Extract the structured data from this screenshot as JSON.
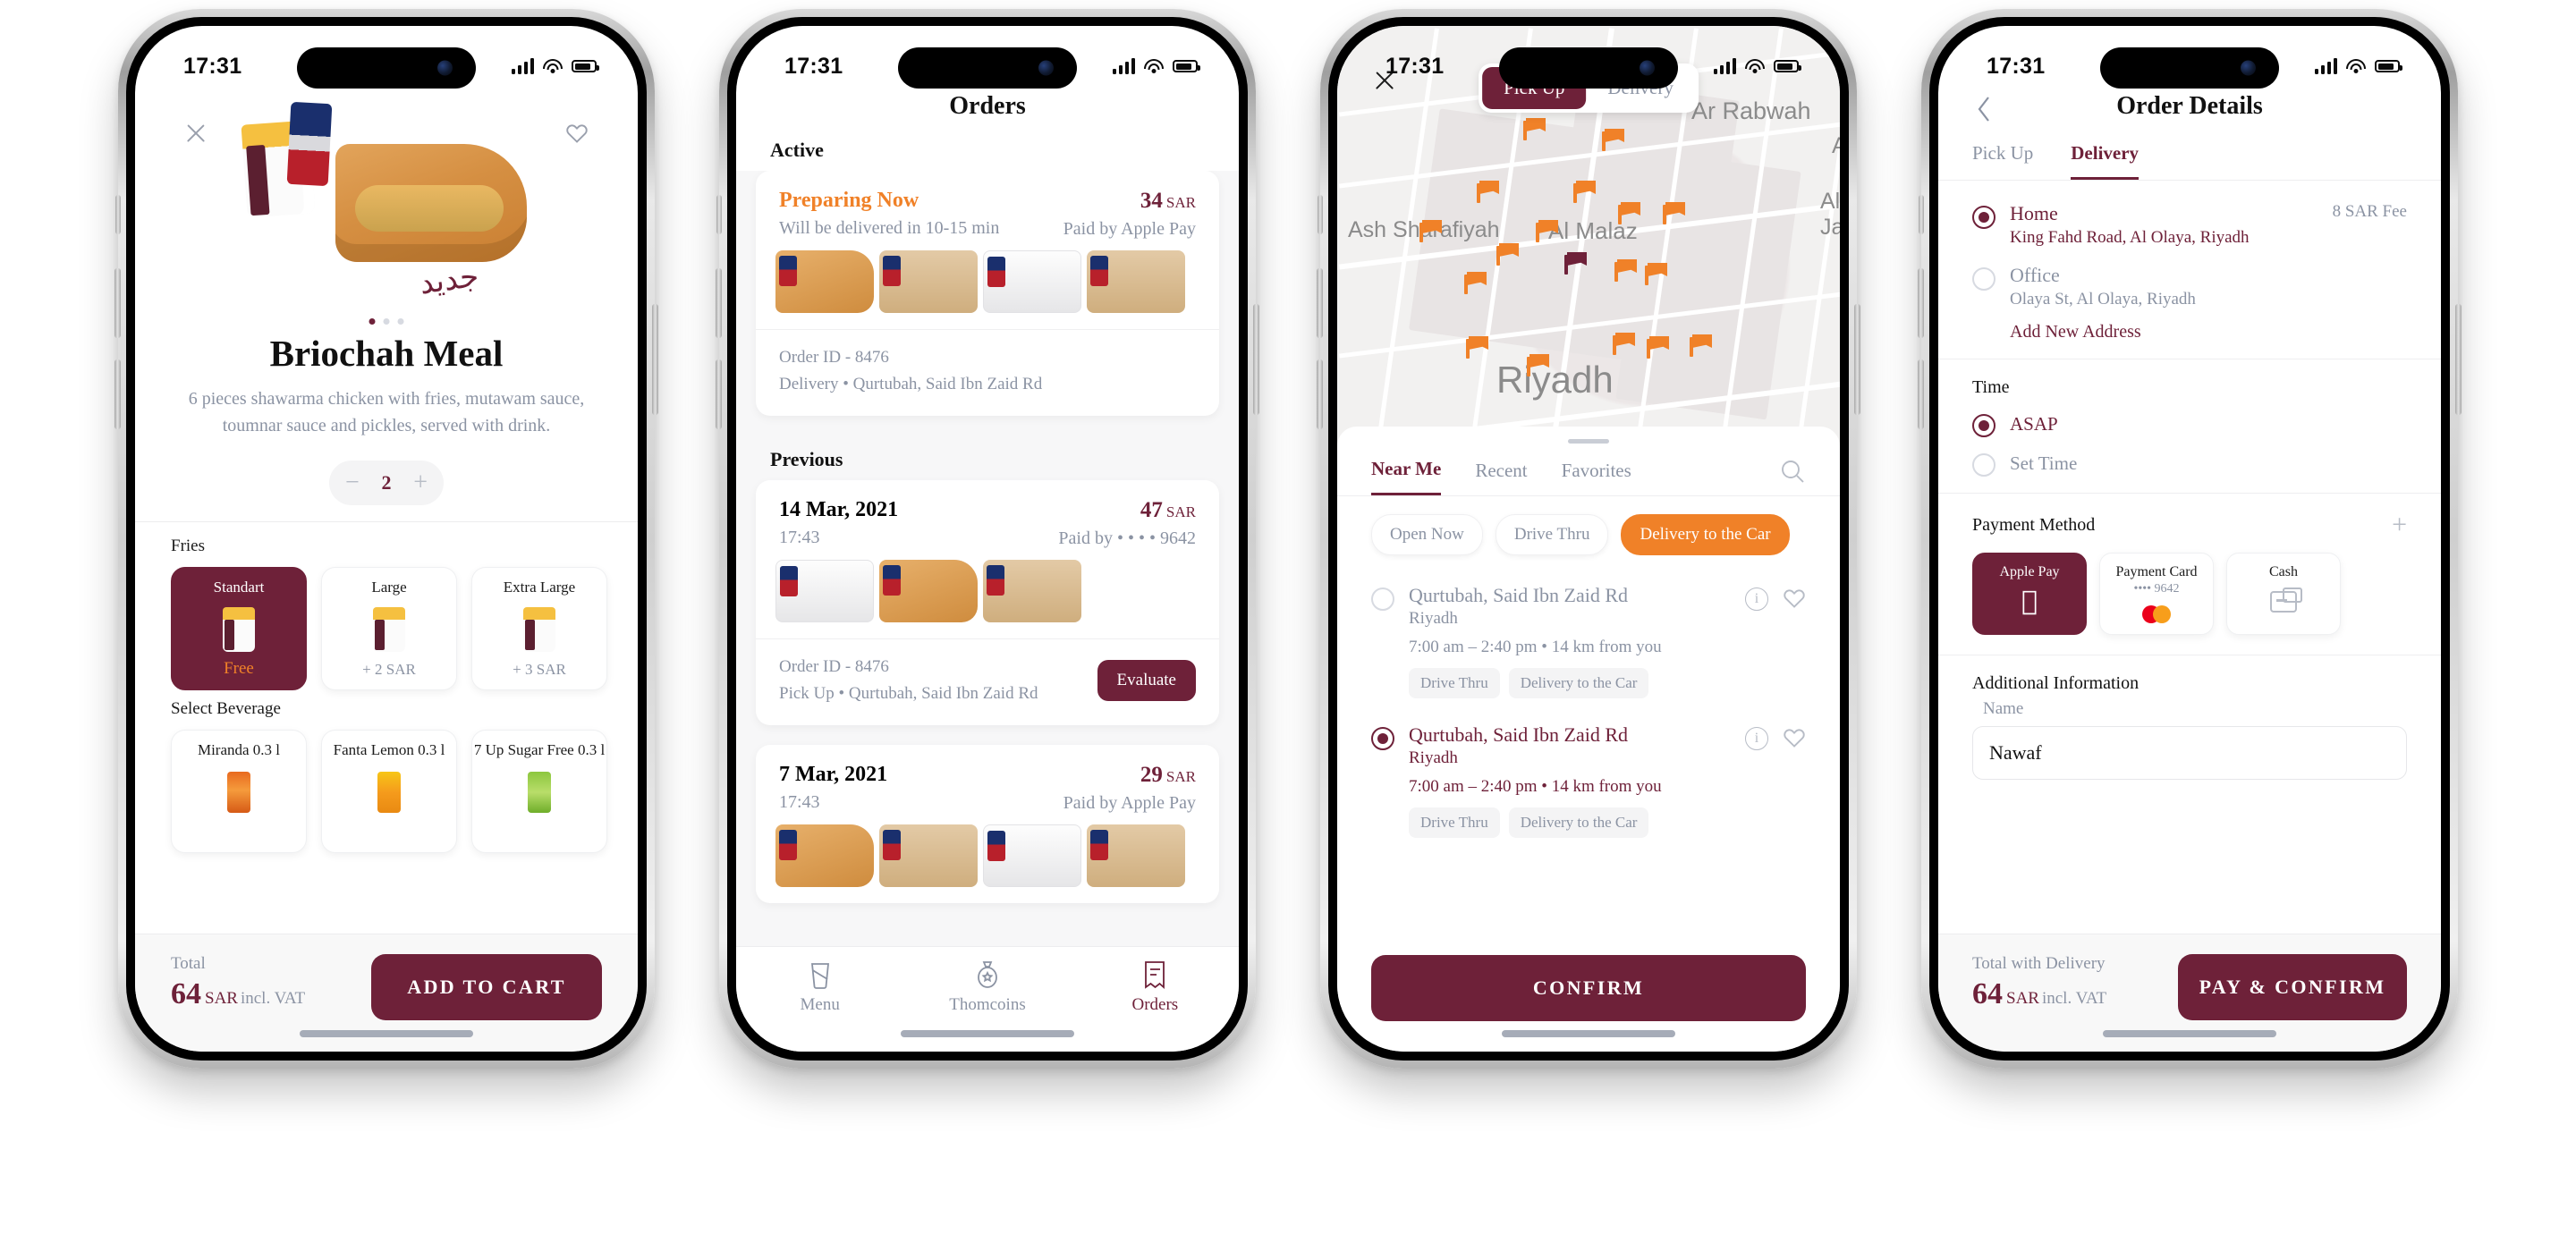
{
  "status_bar": {
    "time": "17:31"
  },
  "phone1": {
    "name": "product-detail-screen",
    "close_icon": "close-icon",
    "favorite_icon": "heart-icon",
    "title": "Briochah Meal",
    "description": "6 pieces shawarma chicken with fries, mutawam sauce, toumnar sauce and pickles, served with drink.",
    "quantity": "2",
    "minus": "−",
    "plus": "+",
    "fries": {
      "label": "Fries",
      "options": [
        {
          "name": "Standart",
          "price": "Free",
          "selected": true
        },
        {
          "name": "Large",
          "price": "+ 2 SAR",
          "selected": false
        },
        {
          "name": "Extra Large",
          "price": "+ 3 SAR",
          "selected": false
        }
      ]
    },
    "beverage": {
      "label": "Select Beverage",
      "options": [
        {
          "name": "Miranda 0.3 l"
        },
        {
          "name": "Fanta Lemon 0.3 l"
        },
        {
          "name": "7 Up Sugar Free 0.3 l"
        }
      ]
    },
    "bottom": {
      "total_label": "Total",
      "total_value": "64",
      "currency": "SAR",
      "vat": "incl. VAT",
      "cta": "ADD TO CART"
    }
  },
  "phone2": {
    "name": "orders-screen",
    "title": "Orders",
    "section_active": "Active",
    "section_previous": "Previous",
    "active_order": {
      "status": "Preparing Now",
      "eta": "Will be delivered in 10-15 min",
      "price": "34",
      "currency": "SAR",
      "paid_by": "Paid by Apple Pay",
      "order_id": "Order ID - 8476",
      "fulfilment": "Delivery  •  Qurtubah, Said Ibn Zaid Rd"
    },
    "previous_orders": [
      {
        "date": "14 Mar, 2021",
        "time": "17:43",
        "price": "47",
        "currency": "SAR",
        "paid_by": "Paid by • • • • 9642",
        "order_id": "Order ID - 8476",
        "fulfilment": "Pick Up  •  Qurtubah, Said Ibn Zaid Rd",
        "evaluate": "Evaluate"
      },
      {
        "date": "7 Mar, 2021",
        "time": "17:43",
        "price": "29",
        "currency": "SAR",
        "paid_by": "Paid by Apple Pay"
      }
    ],
    "tabs": [
      {
        "label": "Menu",
        "icon": "cup-icon",
        "active": false
      },
      {
        "label": "Thomcoins",
        "icon": "coin-bag-icon",
        "active": false
      },
      {
        "label": "Orders",
        "icon": "receipt-icon",
        "active": true
      }
    ]
  },
  "phone3": {
    "name": "store-picker-map-screen",
    "close_icon": "close-icon",
    "segment": [
      {
        "label": "Pick Up",
        "active": true
      },
      {
        "label": "Delivery",
        "active": false
      }
    ],
    "map_labels": [
      "Ar Rabwah",
      "Al Malaz",
      "Ash Sharafiyah",
      "Riyadh",
      "Al Ja",
      "Al"
    ],
    "tabs": [
      {
        "label": "Near Me",
        "active": true
      },
      {
        "label": "Recent",
        "active": false
      },
      {
        "label": "Favorites",
        "active": false
      }
    ],
    "search_icon": "search-icon",
    "filters": [
      {
        "label": "Open Now",
        "active": false
      },
      {
        "label": "Drive Thru",
        "active": false
      },
      {
        "label": "Delivery to the Car",
        "active": true
      }
    ],
    "locations": [
      {
        "name": "Qurtubah, Said Ibn Zaid Rd",
        "city": "Riyadh",
        "meta": "7:00 am – 2:40 pm  •  14 km from you",
        "tags": [
          "Drive Thru",
          "Delivery to the Car"
        ],
        "selected": false
      },
      {
        "name": "Qurtubah, Said Ibn Zaid Rd",
        "city": "Riyadh",
        "meta": "7:00 am – 2:40 pm  •  14 km from you",
        "tags": [
          "Drive Thru",
          "Delivery to the Car"
        ],
        "selected": true
      }
    ],
    "cta": "CONFIRM"
  },
  "phone4": {
    "name": "order-details-screen",
    "back_icon": "chevron-left-icon",
    "title": "Order Details",
    "tabs": [
      {
        "label": "Pick Up",
        "active": false
      },
      {
        "label": "Delivery",
        "active": true
      }
    ],
    "addresses": [
      {
        "name": "Home",
        "sub": "King Fahd Road, Al Olaya, Riyadh",
        "fee": "8 SAR Fee",
        "selected": true
      },
      {
        "name": "Office",
        "sub": "Olaya St, Al Olaya, Riyadh",
        "fee": "",
        "selected": false
      }
    ],
    "add_address": "Add New Address",
    "time": {
      "label": "Time",
      "options": [
        {
          "label": "ASAP",
          "selected": true
        },
        {
          "label": "Set Time",
          "selected": false
        }
      ]
    },
    "payment": {
      "label": "Payment Method",
      "add_icon": "plus-icon",
      "methods": [
        {
          "name": "Apple Pay",
          "sub": "",
          "icon": "apple-logo-icon",
          "selected": true
        },
        {
          "name": "Payment Card",
          "sub": "•••• 9642",
          "icon": "mastercard-icon",
          "selected": false
        },
        {
          "name": "Cash",
          "sub": "",
          "icon": "cash-icon",
          "selected": false
        }
      ]
    },
    "additional": {
      "label": "Additional Information",
      "name_label": "Name",
      "name_value": "Nawaf",
      "name_placeholder": "Name"
    },
    "bottom": {
      "total_label": "Total with Delivery",
      "total_value": "64",
      "currency": "SAR",
      "vat": "incl. VAT",
      "cta": "PAY & CONFIRM"
    }
  },
  "colors": {
    "wine": "#6e2139",
    "orange": "#f08128",
    "muted": "#8b93a3"
  }
}
